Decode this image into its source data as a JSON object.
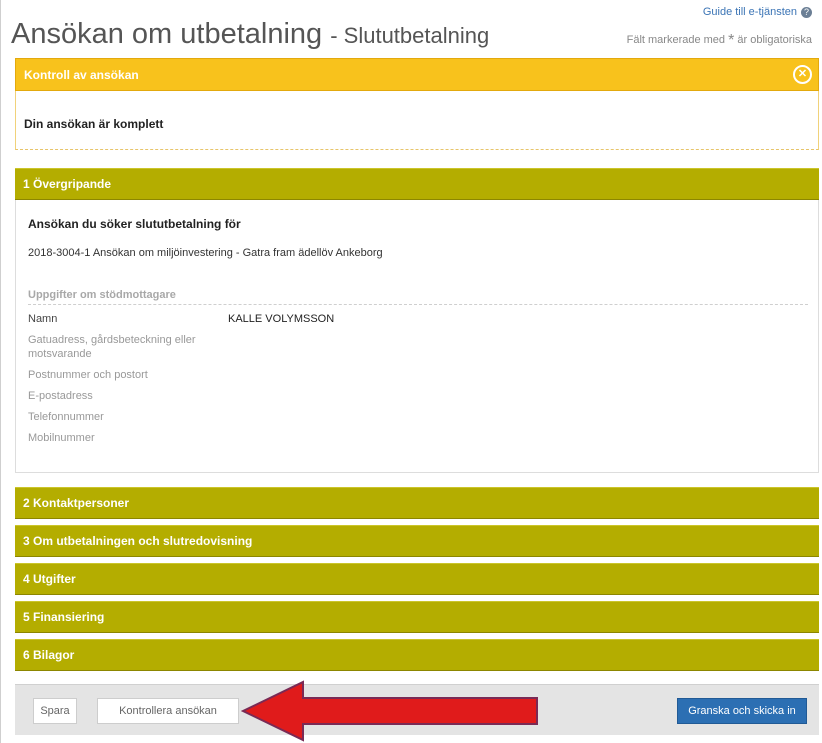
{
  "header": {
    "title": "Ansökan om utbetalning",
    "subtitle": "- Slututbetalning",
    "guide_link": "Guide till e-tjänsten",
    "required_note": "Fält markerade med",
    "required_star": "*",
    "required_note_suffix": "är obligatoriska"
  },
  "alert": {
    "title": "Kontroll av ansökan",
    "message": "Din ansökan är komplett",
    "close_icon": "close-circle-icon"
  },
  "section1": {
    "title": "1 Övergripande",
    "question": "Ansökan du söker slututbetalning för",
    "answer": "2018-3004-1 Ansökan om miljöinvestering - Gatra fram ädellöv Ankeborg",
    "recipient_title": "Uppgifter om stödmottagare",
    "fields": [
      {
        "label": "Namn",
        "value": "KALLE VOLYMSSON"
      },
      {
        "label": "Gatuadress, gårdsbeteckning eller motsvarande",
        "value": ""
      },
      {
        "label": "Postnummer och postort",
        "value": ""
      },
      {
        "label": "E-postadress",
        "value": ""
      },
      {
        "label": "Telefonnummer",
        "value": ""
      },
      {
        "label": "Mobilnummer",
        "value": ""
      }
    ]
  },
  "sections": [
    {
      "title": "2 Kontaktpersoner"
    },
    {
      "title": "3 Om utbetalningen och slutredovisning"
    },
    {
      "title": "4 Utgifter"
    },
    {
      "title": "5 Finansiering"
    },
    {
      "title": "6 Bilagor"
    }
  ],
  "footer": {
    "save": "Spara",
    "check": "Kontrollera ansökan",
    "submit": "Granska och skicka in"
  },
  "colors": {
    "alert": "#f8c21c",
    "section": "#b4ad00",
    "primary_button": "#2c6fb3",
    "arrow": "#e01b1b"
  }
}
